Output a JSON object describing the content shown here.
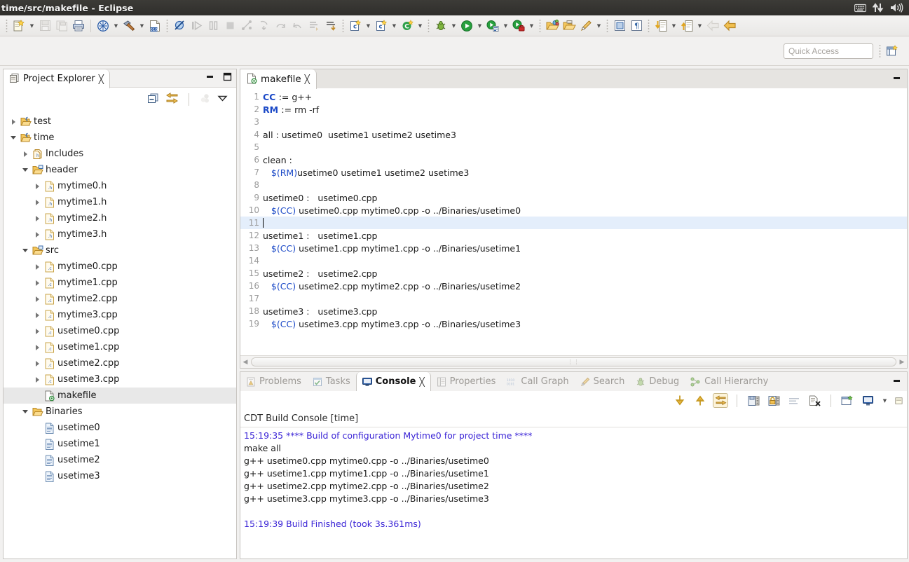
{
  "window": {
    "title": "time/src/makefile - Eclipse",
    "tray_icons": [
      "keyboard-icon",
      "network-icon",
      "volume-icon"
    ]
  },
  "toolbar": {
    "groups": [
      {
        "items": [
          {
            "name": "new-wizard-icon",
            "label": "New",
            "dropdown": true,
            "enabled": true
          },
          {
            "name": "save-icon",
            "label": "Save",
            "dropdown": false,
            "enabled": false
          },
          {
            "name": "save-all-icon",
            "label": "Save All",
            "dropdown": false,
            "enabled": false
          },
          {
            "name": "print-icon",
            "label": "Print",
            "dropdown": false,
            "enabled": true
          }
        ]
      },
      {
        "items": [
          {
            "name": "build-all-icon",
            "label": "Build All",
            "dropdown": true,
            "enabled": true
          },
          {
            "name": "build-hammer-icon",
            "label": "Build",
            "dropdown": true,
            "enabled": true
          },
          {
            "name": "binary-file-icon",
            "label": "Open Element",
            "dropdown": false,
            "enabled": true
          }
        ]
      },
      {
        "items": [
          {
            "name": "skip-breakpoints-icon",
            "label": "Skip All Breakpoints",
            "dropdown": false,
            "enabled": true
          },
          {
            "name": "resume-icon",
            "label": "Resume",
            "dropdown": false,
            "enabled": false
          },
          {
            "name": "suspend-icon",
            "label": "Suspend",
            "dropdown": false,
            "enabled": false
          },
          {
            "name": "terminate-icon",
            "label": "Terminate",
            "dropdown": false,
            "enabled": false
          },
          {
            "name": "disconnect-icon",
            "label": "Disconnect",
            "dropdown": false,
            "enabled": false
          },
          {
            "name": "step-into-icon",
            "label": "Step Into",
            "dropdown": false,
            "enabled": false
          },
          {
            "name": "step-over-icon",
            "label": "Step Over",
            "dropdown": false,
            "enabled": false
          },
          {
            "name": "step-return-icon",
            "label": "Step Return",
            "dropdown": false,
            "enabled": false
          },
          {
            "name": "instruction-stepping-icon",
            "label": "Instruction Stepping",
            "dropdown": false,
            "enabled": false
          },
          {
            "name": "drop-to-frame-icon",
            "label": "Drop To Frame",
            "dropdown": false,
            "enabled": true
          }
        ]
      },
      {
        "items": [
          {
            "name": "new-c-project-icon",
            "label": "New C/C++ Project",
            "dropdown": true,
            "enabled": true
          },
          {
            "name": "new-c-class-icon",
            "label": "New Class",
            "dropdown": true,
            "enabled": true
          },
          {
            "name": "new-c-file-icon",
            "label": "New Source File",
            "dropdown": true,
            "enabled": true
          },
          {
            "name": "open-type-icon",
            "label": "Open Type",
            "dropdown": true,
            "enabled": true
          }
        ]
      },
      {
        "items": [
          {
            "name": "debug-bug-icon",
            "label": "Debug",
            "dropdown": true,
            "enabled": true
          },
          {
            "name": "run-icon",
            "label": "Run",
            "dropdown": true,
            "enabled": true
          },
          {
            "name": "profile-icon",
            "label": "Profile",
            "dropdown": true,
            "enabled": true
          },
          {
            "name": "run-last-tool-icon",
            "label": "Run Last Tool",
            "dropdown": true,
            "enabled": true
          }
        ]
      },
      {
        "items": [
          {
            "name": "open-package-icon",
            "label": "Open Package",
            "dropdown": false,
            "enabled": true
          },
          {
            "name": "open-folder-icon",
            "label": "Open Folder",
            "dropdown": false,
            "enabled": true
          },
          {
            "name": "search-pen-icon",
            "label": "Search",
            "dropdown": true,
            "enabled": true
          }
        ]
      },
      {
        "items": [
          {
            "name": "toggle-block-selection-icon",
            "label": "Toggle Block Selection",
            "dropdown": false,
            "enabled": true
          },
          {
            "name": "show-whitespace-icon",
            "label": "Show Whitespace Characters",
            "dropdown": false,
            "enabled": true
          }
        ]
      },
      {
        "items": [
          {
            "name": "next-annotation-icon",
            "label": "Next Annotation",
            "dropdown": true,
            "enabled": true
          },
          {
            "name": "previous-annotation-icon",
            "label": "Previous Annotation",
            "dropdown": true,
            "enabled": true
          },
          {
            "name": "back-icon",
            "label": "Back",
            "dropdown": false,
            "enabled": false
          },
          {
            "name": "forward-icon",
            "label": "Forward",
            "dropdown": false,
            "enabled": true
          }
        ]
      }
    ]
  },
  "quick_access": {
    "placeholder": "Quick Access",
    "value": "",
    "perspective_icon": "open-perspective-icon"
  },
  "explorer": {
    "tab_label": "Project Explorer",
    "tab_icon": "project-explorer-icon",
    "close_icon": "close-icon",
    "minimize_icon": "minimize-icon",
    "maximize_icon": "maximize-icon",
    "tools": [
      {
        "name": "collapse-all-icon",
        "label": "Collapse All",
        "enabled": true
      },
      {
        "name": "link-with-editor-icon",
        "label": "Link with Editor",
        "enabled": true
      },
      {
        "name": "focus-on-active-task-icon",
        "label": "Focus on Active Task",
        "enabled": false
      },
      {
        "name": "view-menu-icon",
        "label": "View Menu",
        "enabled": true
      }
    ],
    "tree": [
      {
        "label": "test",
        "indent": 0,
        "twisty": "right",
        "icon": "project-folder-icon",
        "selected": false
      },
      {
        "label": "time",
        "indent": 0,
        "twisty": "down",
        "icon": "project-folder-icon",
        "selected": false
      },
      {
        "label": "Includes",
        "indent": 1,
        "twisty": "right",
        "icon": "includes-icon",
        "selected": false
      },
      {
        "label": "header",
        "indent": 1,
        "twisty": "down",
        "icon": "source-folder-icon",
        "selected": false
      },
      {
        "label": "mytime0.h",
        "indent": 2,
        "twisty": "right",
        "icon": "header-file-icon",
        "selected": false
      },
      {
        "label": "mytime1.h",
        "indent": 2,
        "twisty": "right",
        "icon": "header-file-icon",
        "selected": false
      },
      {
        "label": "mytime2.h",
        "indent": 2,
        "twisty": "right",
        "icon": "header-file-icon",
        "selected": false
      },
      {
        "label": "mytime3.h",
        "indent": 2,
        "twisty": "right",
        "icon": "header-file-icon",
        "selected": false
      },
      {
        "label": "src",
        "indent": 1,
        "twisty": "down",
        "icon": "source-folder-icon",
        "selected": false
      },
      {
        "label": "mytime0.cpp",
        "indent": 2,
        "twisty": "right",
        "icon": "cpp-file-icon",
        "selected": false
      },
      {
        "label": "mytime1.cpp",
        "indent": 2,
        "twisty": "right",
        "icon": "cpp-file-icon",
        "selected": false
      },
      {
        "label": "mytime2.cpp",
        "indent": 2,
        "twisty": "right",
        "icon": "cpp-file-icon",
        "selected": false
      },
      {
        "label": "mytime3.cpp",
        "indent": 2,
        "twisty": "right",
        "icon": "cpp-file-icon",
        "selected": false
      },
      {
        "label": "usetime0.cpp",
        "indent": 2,
        "twisty": "right",
        "icon": "cpp-file-icon",
        "selected": false
      },
      {
        "label": "usetime1.cpp",
        "indent": 2,
        "twisty": "right",
        "icon": "cpp-file-icon",
        "selected": false
      },
      {
        "label": "usetime2.cpp",
        "indent": 2,
        "twisty": "right",
        "icon": "cpp-file-icon",
        "selected": false
      },
      {
        "label": "usetime3.cpp",
        "indent": 2,
        "twisty": "right",
        "icon": "cpp-file-icon",
        "selected": false
      },
      {
        "label": "makefile",
        "indent": 2,
        "twisty": "none",
        "icon": "makefile-icon",
        "selected": true
      },
      {
        "label": "Binaries",
        "indent": 1,
        "twisty": "down",
        "icon": "binaries-folder-icon",
        "selected": false
      },
      {
        "label": "usetime0",
        "indent": 2,
        "twisty": "none",
        "icon": "binary-exec-icon",
        "selected": false
      },
      {
        "label": "usetime1",
        "indent": 2,
        "twisty": "none",
        "icon": "binary-exec-icon",
        "selected": false
      },
      {
        "label": "usetime2",
        "indent": 2,
        "twisty": "none",
        "icon": "binary-exec-icon",
        "selected": false
      },
      {
        "label": "usetime3",
        "indent": 2,
        "twisty": "none",
        "icon": "binary-exec-icon",
        "selected": false
      }
    ]
  },
  "editor": {
    "tab_label": "makefile",
    "tab_icon": "makefile-icon",
    "close_icon": "close-icon",
    "minimize_icon": "minimize-icon",
    "lines": [
      {
        "n": "1",
        "segments": [
          {
            "t": "CC ",
            "c": "kw"
          },
          {
            "t": ":= g++",
            "c": ""
          }
        ]
      },
      {
        "n": "2",
        "segments": [
          {
            "t": "RM ",
            "c": "kw"
          },
          {
            "t": ":= rm -rf",
            "c": ""
          }
        ]
      },
      {
        "n": "3",
        "segments": [
          {
            "t": "",
            "c": ""
          }
        ]
      },
      {
        "n": "4",
        "segments": [
          {
            "t": "all : usetime0  usetime1 usetime2 usetime3",
            "c": ""
          }
        ]
      },
      {
        "n": "5",
        "segments": [
          {
            "t": "",
            "c": ""
          }
        ]
      },
      {
        "n": "6",
        "segments": [
          {
            "t": "clean :",
            "c": ""
          }
        ]
      },
      {
        "n": "7",
        "segments": [
          {
            "t": "   ",
            "c": ""
          },
          {
            "t": "$(RM)",
            "c": "var"
          },
          {
            "t": "usetime0 usetime1 usetime2 usetime3",
            "c": ""
          }
        ]
      },
      {
        "n": "8",
        "segments": [
          {
            "t": "",
            "c": ""
          }
        ]
      },
      {
        "n": "9",
        "segments": [
          {
            "t": "usetime0 :   usetime0.cpp",
            "c": ""
          }
        ]
      },
      {
        "n": "10",
        "segments": [
          {
            "t": "   ",
            "c": ""
          },
          {
            "t": "$(CC)",
            "c": "var"
          },
          {
            "t": " usetime0.cpp mytime0.cpp -o ../Binaries/usetime0",
            "c": ""
          }
        ]
      },
      {
        "n": "11",
        "segments": [
          {
            "t": "",
            "c": ""
          }
        ],
        "highlight": true,
        "caret": true
      },
      {
        "n": "12",
        "segments": [
          {
            "t": "usetime1 :   usetime1.cpp",
            "c": ""
          }
        ]
      },
      {
        "n": "13",
        "segments": [
          {
            "t": "   ",
            "c": ""
          },
          {
            "t": "$(CC)",
            "c": "var"
          },
          {
            "t": " usetime1.cpp mytime1.cpp -o ../Binaries/usetime1",
            "c": ""
          }
        ]
      },
      {
        "n": "14",
        "segments": [
          {
            "t": "",
            "c": ""
          }
        ]
      },
      {
        "n": "15",
        "segments": [
          {
            "t": "usetime2 :   usetime2.cpp",
            "c": ""
          }
        ]
      },
      {
        "n": "16",
        "segments": [
          {
            "t": "   ",
            "c": ""
          },
          {
            "t": "$(CC)",
            "c": "var"
          },
          {
            "t": " usetime2.cpp mytime2.cpp -o ../Binaries/usetime2",
            "c": ""
          }
        ]
      },
      {
        "n": "17",
        "segments": [
          {
            "t": "",
            "c": ""
          }
        ]
      },
      {
        "n": "18",
        "segments": [
          {
            "t": "usetime3 :   usetime3.cpp",
            "c": ""
          }
        ]
      },
      {
        "n": "19",
        "segments": [
          {
            "t": "   ",
            "c": ""
          },
          {
            "t": "$(CC)",
            "c": "var"
          },
          {
            "t": " usetime3.cpp mytime3.cpp -o ../Binaries/usetime3",
            "c": ""
          }
        ]
      }
    ]
  },
  "console": {
    "tabs": [
      {
        "label": "Problems",
        "icon": "problems-icon",
        "active": false
      },
      {
        "label": "Tasks",
        "icon": "tasks-icon",
        "active": false
      },
      {
        "label": "Console",
        "icon": "console-icon",
        "active": true
      },
      {
        "label": "Properties",
        "icon": "properties-icon",
        "active": false
      },
      {
        "label": "Call Graph",
        "icon": "call-graph-icon",
        "active": false
      },
      {
        "label": "Search",
        "icon": "search-icon",
        "active": false
      },
      {
        "label": "Debug",
        "icon": "debug-icon",
        "active": false
      },
      {
        "label": "Call Hierarchy",
        "icon": "call-hierarchy-icon",
        "active": false
      }
    ],
    "close_icon": "close-icon",
    "minimize_icon": "minimize-icon",
    "tools": [
      {
        "name": "scroll-down-icon",
        "label": "Scroll Lock Down",
        "pressed": false
      },
      {
        "name": "scroll-up-icon",
        "label": "Scroll Lock Up",
        "pressed": false
      },
      {
        "name": "link-console-icon",
        "label": "Pin Console",
        "pressed": true
      },
      {
        "name": "save-console-icon",
        "label": "Save Console",
        "pressed": false
      },
      {
        "name": "lock-console-icon",
        "label": "Scroll Lock",
        "pressed": false
      },
      {
        "name": "word-wrap-icon",
        "label": "Word Wrap",
        "pressed": false
      },
      {
        "name": "clear-console-icon",
        "label": "Clear Console",
        "pressed": false
      },
      {
        "name": "new-console-view-icon",
        "label": "Open Console",
        "pressed": false
      },
      {
        "name": "display-selected-console-icon",
        "label": "Display Selected Console",
        "pressed": false
      },
      {
        "name": "open-console-icon",
        "label": "Open Console",
        "pressed": false
      }
    ],
    "title": "CDT Build Console [time]",
    "output": [
      {
        "text": "15:19:35 **** Build of configuration Mytime0 for project time ****",
        "style": "blue"
      },
      {
        "text": "make all",
        "style": ""
      },
      {
        "text": "g++ usetime0.cpp mytime0.cpp -o ../Binaries/usetime0",
        "style": ""
      },
      {
        "text": "g++ usetime1.cpp mytime1.cpp -o ../Binaries/usetime1",
        "style": ""
      },
      {
        "text": "g++ usetime2.cpp mytime2.cpp -o ../Binaries/usetime2",
        "style": ""
      },
      {
        "text": "g++ usetime3.cpp mytime3.cpp -o ../Binaries/usetime3",
        "style": ""
      },
      {
        "text": "",
        "style": ""
      },
      {
        "text": "15:19:39 Build Finished (took 3s.361ms)",
        "style": "blue"
      }
    ]
  },
  "colors": {
    "titlebar": "#2f2e2b",
    "toolbar": "#ece9e6",
    "selection": "#e8e8e8",
    "line_highlight": "#e4eefb",
    "keyword_blue": "#1b49c7",
    "console_blue": "#3a24d6"
  }
}
